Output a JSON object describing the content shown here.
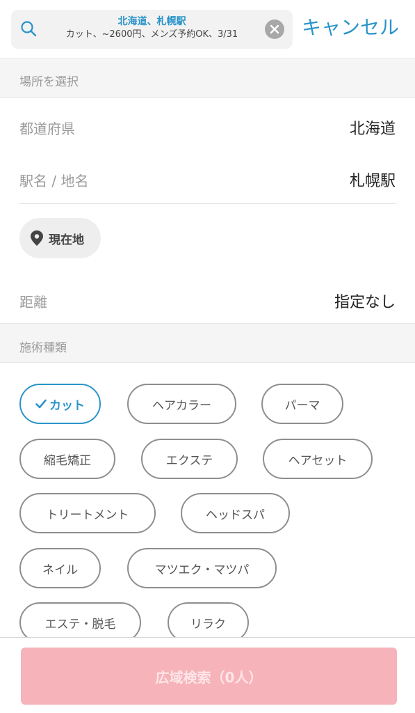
{
  "search": {
    "title": "北海道、札幌駅",
    "subtitle": "カット、~2600円、メンズ予約OK、3/31",
    "cancel_label": "キャンセル"
  },
  "location_section": {
    "header": "場所を選択",
    "prefecture_label": "都道府県",
    "prefecture_value": "北海道",
    "station_label": "駅名 / 地名",
    "station_value": "札幌駅",
    "current_location_label": "現在地",
    "distance_label": "距離",
    "distance_value": "指定なし"
  },
  "treatment_section": {
    "header": "施術種類",
    "chips": [
      {
        "label": "カット",
        "selected": true
      },
      {
        "label": "ヘアカラー",
        "selected": false
      },
      {
        "label": "パーマ",
        "selected": false
      },
      {
        "label": "縮毛矯正",
        "selected": false
      },
      {
        "label": "エクステ",
        "selected": false
      },
      {
        "label": "ヘアセット",
        "selected": false
      },
      {
        "label": "トリートメント",
        "selected": false
      },
      {
        "label": "ヘッドスパ",
        "selected": false
      },
      {
        "label": "ネイル",
        "selected": false
      },
      {
        "label": "マツエク・マツパ",
        "selected": false
      },
      {
        "label": "エステ・脱毛",
        "selected": false
      },
      {
        "label": "リラク",
        "selected": false
      }
    ]
  },
  "footer": {
    "search_button_label": "広域検索（0人）"
  },
  "colors": {
    "accent": "#2a93c9",
    "button_disabled": "#f6b3b9",
    "section_bg": "#f5f5f5"
  },
  "icons": [
    "search-icon",
    "clear-icon",
    "location-pin-icon",
    "check-icon"
  ]
}
